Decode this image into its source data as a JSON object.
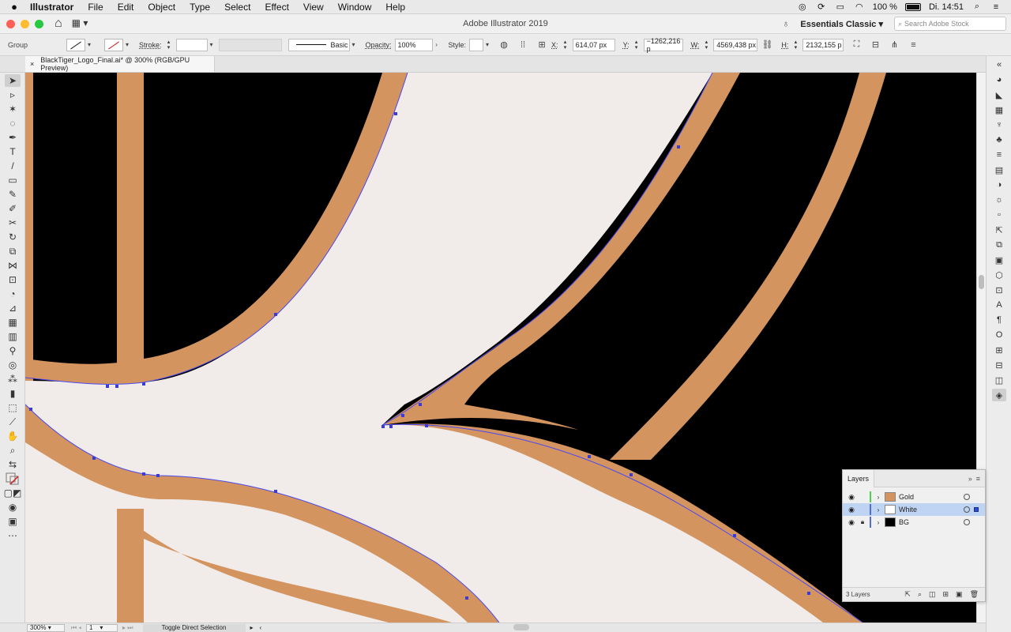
{
  "menubar": {
    "apple": "",
    "app_name": "Illustrator",
    "items": [
      "File",
      "Edit",
      "Object",
      "Type",
      "Select",
      "Effect",
      "View",
      "Window",
      "Help"
    ],
    "battery": "100 %",
    "clock": "Di. 14:51"
  },
  "titlebar": {
    "title": "Adobe Illustrator 2019",
    "workspace": "Essentials Classic",
    "search_placeholder": "Search Adobe Stock"
  },
  "controlbar": {
    "selection": "Group",
    "stroke_label": "Stroke:",
    "brush": "Basic",
    "opacity_label": "Opacity:",
    "opacity_value": "100%",
    "style_label": "Style:",
    "x_label": "X:",
    "x_value": "614,07 px",
    "y_label": "Y:",
    "y_value": "−1262,216 p",
    "w_label": "W:",
    "w_value": "4569,438 px",
    "h_label": "H:",
    "h_value": "2132,155 p"
  },
  "document": {
    "tab_label": "BlackTiger_Logo_Final.ai* @ 300% (RGB/GPU Preview)"
  },
  "statusbar": {
    "zoom": "300%",
    "artboard": "1",
    "status": "Toggle Direct Selection"
  },
  "layers_panel": {
    "tab": "Layers",
    "layers": [
      {
        "name": "Gold",
        "color": "#4fd14f",
        "thumb": "#d4945f",
        "locked": false,
        "selected": false
      },
      {
        "name": "White",
        "color": "#4f6fd1",
        "thumb": "#ffffff",
        "locked": false,
        "selected": true
      },
      {
        "name": "BG",
        "color": "#4f6fd1",
        "thumb": "#000000",
        "locked": true,
        "selected": false
      }
    ],
    "count": "3 Layers"
  },
  "colors": {
    "gold": "#d4945f",
    "white_shape": "#f1ecea",
    "background": "#000000",
    "path_outline": "#4a4af0"
  }
}
